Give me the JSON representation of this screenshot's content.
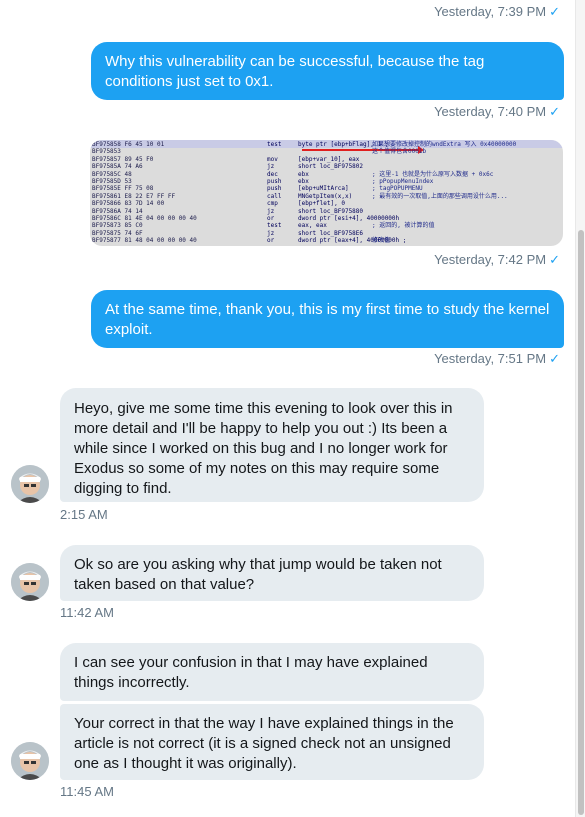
{
  "messages": [
    {
      "side": "out",
      "stamp": "Yesterday, 7:39 PM",
      "read": true
    },
    {
      "side": "out",
      "text": "Why this vulnerability can be successful, because the tag conditions just set to 0x1.",
      "stamp": "Yesterday, 7:40 PM",
      "read": true
    },
    {
      "side": "out",
      "type": "image",
      "stamp": "Yesterday, 7:42 PM",
      "read": true
    },
    {
      "side": "out",
      "text": "At the same time, thank you, this is my first time to study the kernel exploit.",
      "stamp": "Yesterday, 7:51 PM",
      "read": true
    },
    {
      "side": "in",
      "text": "Heyo, give me some time this evening to look over this in more detail and I'll be happy to help you out :) Its been a while since I worked on this bug and I no longer work for Exodus so some of my notes on this may require some digging to find.",
      "stamp": "2:15 AM"
    },
    {
      "side": "in",
      "text": "Ok so are you asking why that jump would be taken not taken based on that value?",
      "stamp": "11:42 AM"
    },
    {
      "side": "in",
      "text": "I can see your confusion in that I may have explained things incorrectly."
    },
    {
      "side": "in",
      "text": "Your correct in that the way I have explained things in the article is not correct (it is a signed check not an unsigned one as I thought it was originally).",
      "stamp": "11:45 AM"
    }
  ],
  "check_glyph": "✓",
  "asm_image": {
    "rows": [
      {
        "addr": "BF975858 F6 45 10 01",
        "op": "test",
        "arg": "byte ptr [ebp+bFlag], 1 ;",
        "cmt": "如果想要修改掉控制的wndExtra 写入 0x40000000"
      },
      {
        "addr": "BF975853",
        "op": "",
        "arg": "",
        "cmt": "这个值得包含0001b"
      },
      {
        "addr": "BF975857 89 45 F0",
        "op": "mov",
        "arg": "[ebp+var_10], eax",
        "cmt": ""
      },
      {
        "addr": "BF97585A 74 A6",
        "op": "jz",
        "arg": "short loc_BF975802",
        "cmt": ""
      },
      {
        "addr": "BF97585C 48",
        "op": "dec",
        "arg": "ebx",
        "cmt": "; 这里-1  也就是为什么原写入数据 + 0x6c"
      },
      {
        "addr": "BF97585D 53",
        "op": "push",
        "arg": "ebx",
        "cmt": "; pPopupMenuIndex"
      },
      {
        "addr": "BF97585E FF 75 08",
        "op": "push",
        "arg": "[ebp+uMItArca]",
        "cmt": "; tagPOPUPMENU"
      },
      {
        "addr": "BF975861 E8 22 E7 FF FF",
        "op": "call",
        "arg": "MNGetpItem(x,x)",
        "cmt": "; 最有效的一次取值,上面的那些调用设什么用..."
      },
      {
        "addr": "BF975866 83 7D 14 00",
        "op": "cmp",
        "arg": "[ebp+flet], 0",
        "cmt": ""
      },
      {
        "addr": "BF97586A 74 14",
        "op": "jz",
        "arg": "short loc_BF975880",
        "cmt": ""
      },
      {
        "addr": "BF97586C 81 4E 04 00 00 00 40",
        "op": "or",
        "arg": "dword ptr [esi+4], 40000000h",
        "cmt": ""
      },
      {
        "addr": "BF975873 85 C0",
        "op": "test",
        "arg": "eax, eax",
        "cmt": "; 返回的, 被计算的值"
      },
      {
        "addr": "BF975875 74 6F",
        "op": "jz",
        "arg": "short loc_BF9758E6",
        "cmt": ""
      },
      {
        "addr": "BF975877 81 48 04 00 00 00 40",
        "op": "or",
        "arg": "dword ptr [eax+4], 40000000h ;",
        "cmt": "修改值"
      }
    ]
  }
}
